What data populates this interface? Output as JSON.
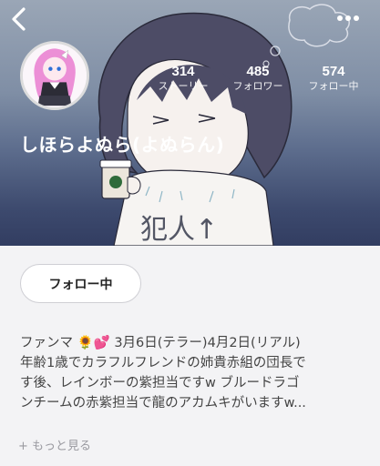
{
  "header": {
    "back_icon": "chevron-left-icon",
    "more_icon": "more-horizontal-icon"
  },
  "cover": {
    "handwriting": "犯人↑"
  },
  "profile": {
    "name": "しほらよぬら(よぬらん)",
    "stats": [
      {
        "value": "314",
        "label": "ストーリー"
      },
      {
        "value": "485",
        "label": "フォロワー"
      },
      {
        "value": "574",
        "label": "フォロー中"
      }
    ]
  },
  "actions": {
    "follow_label": "フォロー中"
  },
  "bio": {
    "lines": [
      "ファンマ 🌻💕 3月6日(テラー)4月2日(リアル)",
      "年齢1歳でカラフルフレンドの姉貴赤組の団長で",
      "す後、レインボーの紫担当ですw ブルードラゴ",
      "ンチームの赤紫担当で龍のアカムキがいますw..."
    ],
    "more_label": "+ もっと見る"
  }
}
